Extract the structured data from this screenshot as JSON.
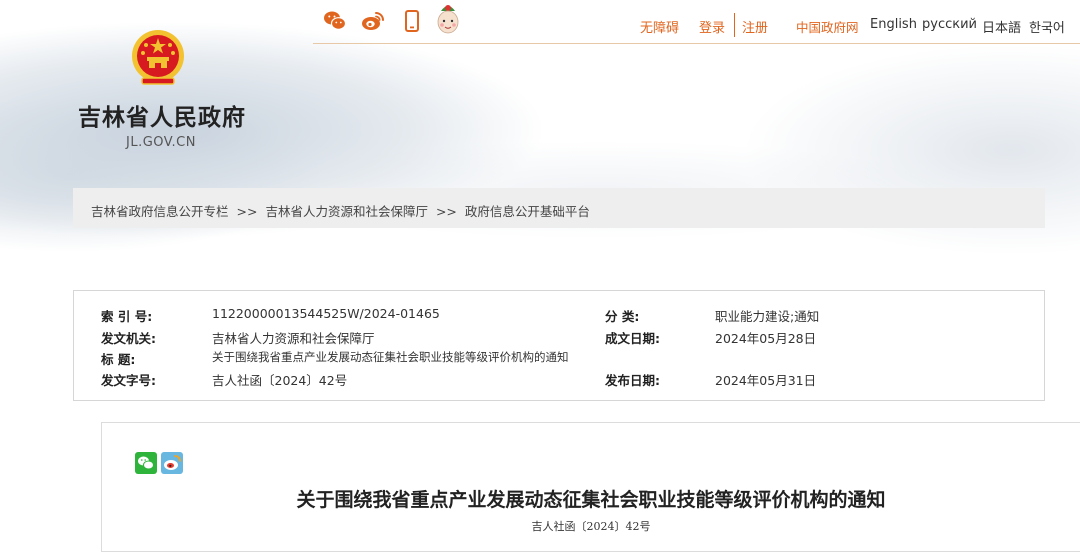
{
  "site": {
    "title": "吉林省人民政府",
    "domain": "JL.GOV.CN"
  },
  "top_icons": [
    {
      "name": "wechat-icon",
      "color": "#e0651f"
    },
    {
      "name": "weibo-icon",
      "color": "#e0651f"
    },
    {
      "name": "mobile-icon",
      "color": "#e0651f"
    },
    {
      "name": "mascot-icon"
    }
  ],
  "top_links": {
    "accessibility": "无障碍",
    "login": "登录",
    "register": "注册",
    "china_gov": "中国政府网",
    "english": "English",
    "russian": "русский",
    "japanese": "日本語",
    "korean": "한국어"
  },
  "breadcrumb": {
    "items": [
      "吉林省政府信息公开专栏",
      "吉林省人力资源和社会保障厅",
      "政府信息公开基础平台"
    ],
    "separator": ">>"
  },
  "meta": {
    "index_label": "索 引 号:",
    "index_value": "11220000013544525W/2024-01465",
    "category_label": "分    类:",
    "category_value": "职业能力建设;通知",
    "issuer_label": "发文机关:",
    "issuer_value": "吉林省人力资源和社会保障厅",
    "created_label": "成文日期:",
    "created_value": "2024年05月28日",
    "title_label": "标    题:",
    "title_value": "关于围绕我省重点产业发展动态征集社会职业技能等级评价机构的通知",
    "docno_label": "发文字号:",
    "docno_value": "吉人社函〔2024〕42号",
    "published_label": "发布日期:",
    "published_value": "2024年05月31日"
  },
  "article": {
    "title": "关于围绕我省重点产业发展动态征集社会职业技能等级评价机构的通知",
    "docno": "吉人社函〔2024〕42号",
    "share_icons": [
      "wechat-share-icon",
      "weibo-share-icon"
    ]
  },
  "colors": {
    "accent": "#e0651f",
    "emblem_red": "#d71920",
    "emblem_gold": "#f2c230",
    "wechat_green": "#2fb43b",
    "weibo_blue": "#67b7e1"
  }
}
